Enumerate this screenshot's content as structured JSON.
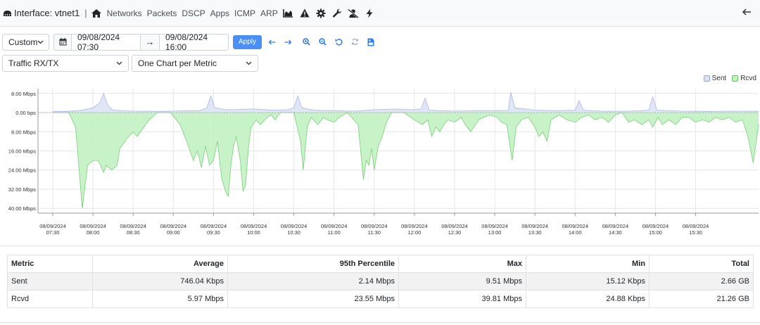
{
  "header": {
    "title": "Interface: vtnet1",
    "separator": "|",
    "nav": [
      {
        "label": "Networks"
      },
      {
        "label": "Packets"
      },
      {
        "label": "DSCP"
      },
      {
        "label": "Apps"
      },
      {
        "label": "ICMP"
      },
      {
        "label": "ARP"
      }
    ],
    "icons": [
      "server-icon",
      "home-icon",
      "area-chart-icon",
      "alert-icon",
      "gear-icon",
      "wrench-icon",
      "user-slash-icon",
      "bolt-icon",
      "back-arrow-icon"
    ]
  },
  "toolbar": {
    "range_select": "Custom",
    "start": "09/08/2024 07:30",
    "arrow": "→",
    "end": "09/08/2024 16:00",
    "apply": "Apply"
  },
  "selects": {
    "metric": "Traffic RX/TX",
    "layout": "One Chart per Metric"
  },
  "legend": [
    {
      "name": "Sent",
      "color": "#dde3f5"
    },
    {
      "name": "Rcvd",
      "color": "#c2f2c2"
    }
  ],
  "chart_data": {
    "type": "area",
    "ytick_labels": [
      "8.00 Mbps",
      "0.00 bps",
      "8.00 Mbps",
      "16.00 Mbps",
      "24.00 Mbps",
      "32.00 Mbps",
      "40.00 Mbps"
    ],
    "xtick_labels": [
      {
        "date": "08/09/2024",
        "time": "07:30"
      },
      {
        "date": "08/09/2024",
        "time": "08:00"
      },
      {
        "date": "08/09/2024",
        "time": "08:30"
      },
      {
        "date": "08/09/2024",
        "time": "09:00"
      },
      {
        "date": "08/09/2024",
        "time": "09:30"
      },
      {
        "date": "08/09/2024",
        "time": "10:00"
      },
      {
        "date": "08/09/2024",
        "time": "10:30"
      },
      {
        "date": "08/09/2024",
        "time": "11:00"
      },
      {
        "date": "08/09/2024",
        "time": "11:30"
      },
      {
        "date": "08/09/2024",
        "time": "12:00"
      },
      {
        "date": "08/09/2024",
        "time": "12:30"
      },
      {
        "date": "08/09/2024",
        "time": "13:00"
      },
      {
        "date": "08/09/2024",
        "time": "13:30"
      },
      {
        "date": "08/09/2024",
        "time": "14:00"
      },
      {
        "date": "08/09/2024",
        "time": "14:30"
      },
      {
        "date": "08/09/2024",
        "time": "15:00"
      },
      {
        "date": "08/09/2024",
        "time": "15:30"
      }
    ],
    "y_unit": "Mbps",
    "ylim": [
      -42,
      10
    ],
    "x_minutes_range": [
      0,
      527
    ],
    "grid": true,
    "legend_position": "top-right",
    "series": [
      {
        "name": "Sent",
        "color": "#dde3f5",
        "stroke": "#aab7e6",
        "points": [
          [
            0,
            0.5
          ],
          [
            10,
            0.5
          ],
          [
            20,
            0.8
          ],
          [
            30,
            2
          ],
          [
            35,
            4
          ],
          [
            38,
            8
          ],
          [
            41,
            3
          ],
          [
            45,
            1
          ],
          [
            60,
            0.6
          ],
          [
            80,
            0.5
          ],
          [
            95,
            0.7
          ],
          [
            110,
            0.8
          ],
          [
            115,
            2
          ],
          [
            118,
            7
          ],
          [
            121,
            2
          ],
          [
            130,
            1.2
          ],
          [
            150,
            1.5
          ],
          [
            165,
            1
          ],
          [
            175,
            1.2
          ],
          [
            180,
            2
          ],
          [
            183,
            7
          ],
          [
            186,
            2
          ],
          [
            195,
            1
          ],
          [
            210,
            0.8
          ],
          [
            225,
            0.6
          ],
          [
            240,
            1.2
          ],
          [
            255,
            1.5
          ],
          [
            268,
            1.2
          ],
          [
            275,
            1.5
          ],
          [
            278,
            6
          ],
          [
            281,
            1
          ],
          [
            300,
            0.6
          ],
          [
            315,
            0.8
          ],
          [
            330,
            0.8
          ],
          [
            340,
            0.9
          ],
          [
            342,
            8.5
          ],
          [
            345,
            2
          ],
          [
            360,
            1
          ],
          [
            375,
            0.8
          ],
          [
            390,
            1
          ],
          [
            393,
            5
          ],
          [
            396,
            1
          ],
          [
            410,
            0.6
          ],
          [
            430,
            0.6
          ],
          [
            445,
            1
          ],
          [
            448,
            6.5
          ],
          [
            451,
            1
          ],
          [
            470,
            0.6
          ],
          [
            490,
            0.5
          ],
          [
            510,
            0.6
          ],
          [
            527,
            0.5
          ]
        ]
      },
      {
        "name": "Rcvd",
        "color": "#c2f2c2",
        "stroke": "#76cf76",
        "points": [
          [
            0,
            0
          ],
          [
            12,
            0
          ],
          [
            17,
            -6
          ],
          [
            22,
            -40
          ],
          [
            26,
            -22
          ],
          [
            30,
            -20
          ],
          [
            34,
            -20
          ],
          [
            38,
            -25
          ],
          [
            40,
            -22
          ],
          [
            44,
            -24
          ],
          [
            48,
            -22
          ],
          [
            50,
            -15
          ],
          [
            55,
            -11
          ],
          [
            60,
            -8
          ],
          [
            63,
            -10
          ],
          [
            68,
            -6
          ],
          [
            72,
            -3
          ],
          [
            78,
            0
          ],
          [
            88,
            0
          ],
          [
            95,
            -5
          ],
          [
            100,
            -12
          ],
          [
            105,
            -20
          ],
          [
            108,
            -16
          ],
          [
            111,
            -23
          ],
          [
            114,
            -14
          ],
          [
            117,
            -22
          ],
          [
            120,
            -20
          ],
          [
            123,
            -12
          ],
          [
            126,
            -27
          ],
          [
            129,
            -33
          ],
          [
            131,
            -35
          ],
          [
            133,
            -22
          ],
          [
            135,
            -14
          ],
          [
            137,
            -10
          ],
          [
            140,
            -20
          ],
          [
            142,
            -33
          ],
          [
            144,
            -30
          ],
          [
            146,
            -15
          ],
          [
            148,
            -6
          ],
          [
            152,
            -3
          ],
          [
            155,
            -5
          ],
          [
            160,
            -2
          ],
          [
            163,
            -1
          ],
          [
            166,
            -3
          ],
          [
            170,
            0
          ],
          [
            180,
            0
          ],
          [
            185,
            -12
          ],
          [
            187,
            -24
          ],
          [
            190,
            -6
          ],
          [
            193,
            -2
          ],
          [
            198,
            -5
          ],
          [
            202,
            -2
          ],
          [
            205,
            -3
          ],
          [
            210,
            -4
          ],
          [
            214,
            -2
          ],
          [
            220,
            0
          ],
          [
            228,
            -5
          ],
          [
            232,
            -28
          ],
          [
            234,
            -20
          ],
          [
            236,
            -22
          ],
          [
            238,
            -15
          ],
          [
            240,
            -24
          ],
          [
            243,
            -14
          ],
          [
            246,
            -10
          ],
          [
            248,
            -6
          ],
          [
            250,
            -3
          ],
          [
            253,
            0
          ],
          [
            262,
            0
          ],
          [
            270,
            -3
          ],
          [
            276,
            -5
          ],
          [
            280,
            -3
          ],
          [
            283,
            -10
          ],
          [
            286,
            -6
          ],
          [
            289,
            -8
          ],
          [
            292,
            -5
          ],
          [
            295,
            -3
          ],
          [
            300,
            -4
          ],
          [
            305,
            -2
          ],
          [
            308,
            -5
          ],
          [
            312,
            -8
          ],
          [
            318,
            -3
          ],
          [
            322,
            -2
          ],
          [
            326,
            -1
          ],
          [
            332,
            -2
          ],
          [
            335,
            -4
          ],
          [
            339,
            -5
          ],
          [
            343,
            -20
          ],
          [
            346,
            -6
          ],
          [
            350,
            -3
          ],
          [
            355,
            -2
          ],
          [
            360,
            -6
          ],
          [
            363,
            -10
          ],
          [
            366,
            -8
          ],
          [
            369,
            -12
          ],
          [
            372,
            -3
          ],
          [
            378,
            -1
          ],
          [
            384,
            -3
          ],
          [
            390,
            -4
          ],
          [
            395,
            -2
          ],
          [
            400,
            -1
          ],
          [
            405,
            -3
          ],
          [
            410,
            -2
          ],
          [
            415,
            -4
          ],
          [
            420,
            -1
          ],
          [
            425,
            0
          ],
          [
            430,
            -4
          ],
          [
            434,
            -3
          ],
          [
            440,
            -5
          ],
          [
            445,
            -3
          ],
          [
            448,
            -6
          ],
          [
            452,
            -2
          ],
          [
            455,
            -5
          ],
          [
            460,
            -3
          ],
          [
            465,
            -5
          ],
          [
            470,
            -2
          ],
          [
            475,
            -2
          ],
          [
            480,
            -4
          ],
          [
            485,
            -3
          ],
          [
            490,
            -4
          ],
          [
            495,
            -2
          ],
          [
            500,
            -3
          ],
          [
            505,
            -2
          ],
          [
            510,
            -4
          ],
          [
            515,
            -3
          ],
          [
            519,
            -10
          ],
          [
            523,
            -21
          ],
          [
            527,
            -5
          ]
        ]
      }
    ]
  },
  "table": {
    "headers": [
      "Metric",
      "Average",
      "95th Percentile",
      "Max",
      "Min",
      "Total"
    ],
    "rows": [
      [
        "Sent",
        "746.04 Kbps",
        "2.14 Mbps",
        "9.51 Mbps",
        "15.12 Kbps",
        "2.66 GB"
      ],
      [
        "Rcvd",
        "5.97 Mbps",
        "23.55 Mbps",
        "39.81 Mbps",
        "24.88 Kbps",
        "21.26 GB"
      ]
    ]
  }
}
